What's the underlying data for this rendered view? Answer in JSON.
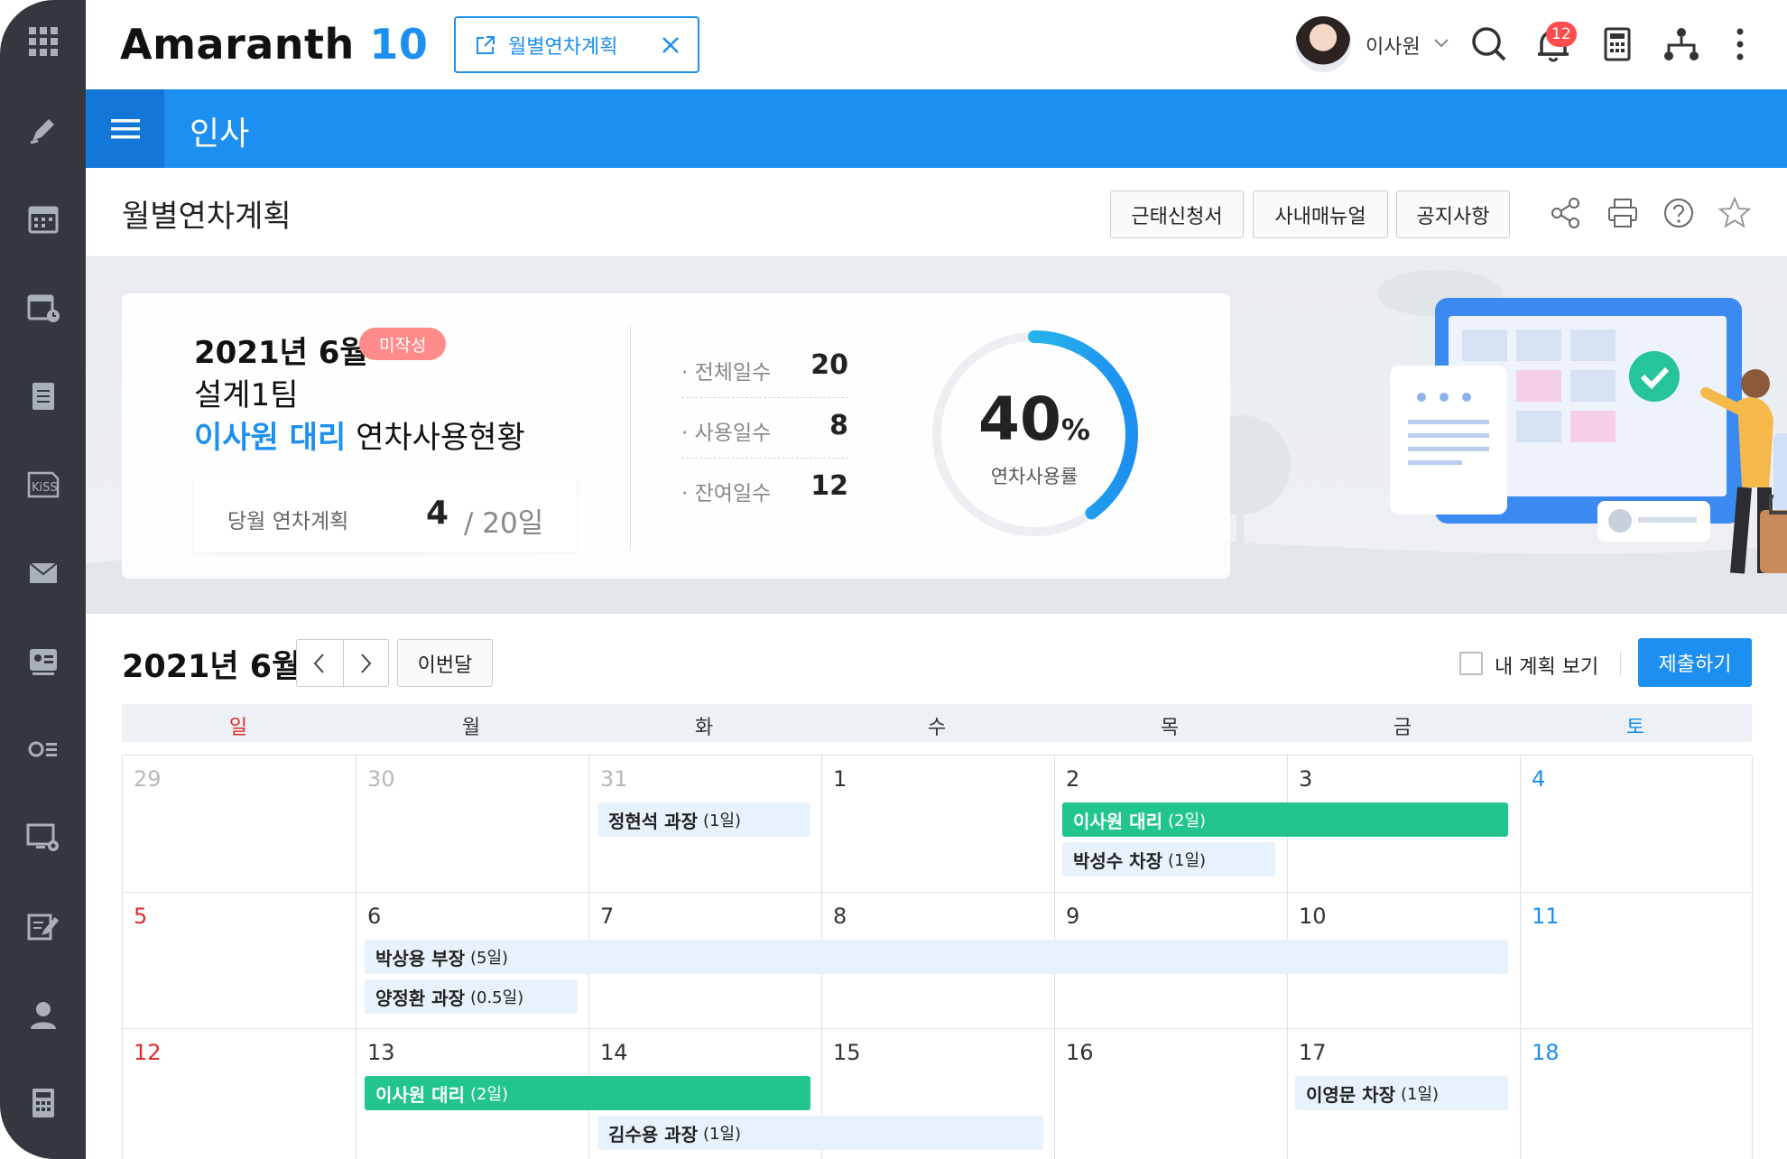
{
  "app": {
    "logo_text": "Amaranth",
    "logo_num": "10"
  },
  "open_tab": {
    "label": "월별연차계획"
  },
  "user": {
    "name": "이사원",
    "notification_count": "12"
  },
  "module": {
    "title": "인사"
  },
  "page": {
    "title": "월별연차계획",
    "buttons": [
      "근태신청서",
      "사내매뉴얼",
      "공지사항"
    ]
  },
  "summary": {
    "date": "2021년 6월",
    "status_badge": "미작성",
    "team": "설계1팀",
    "person_highlight": "이사원 대리",
    "person_suffix": "연차사용현황",
    "plan_label": "당월 연차계획",
    "plan_value": "4",
    "plan_total": "/ 20일",
    "stats": [
      {
        "label": "· 전체일수",
        "value": "20"
      },
      {
        "label": "· 사용일수",
        "value": "8"
      },
      {
        "label": "· 잔여일수",
        "value": "12"
      }
    ],
    "usage_percent": "40",
    "usage_percent_unit": "%",
    "usage_fraction": 0.4,
    "usage_label": "연차사용률"
  },
  "calendar": {
    "month_label": "2021년 6월",
    "this_month_label": "이번달",
    "my_plan_label": "내 계획 보기",
    "submit_label": "제출하기",
    "weekdays": [
      "일",
      "월",
      "화",
      "수",
      "목",
      "금",
      "토"
    ],
    "weeks": [
      [
        "29",
        "30",
        "31",
        "1",
        "2",
        "3",
        "4"
      ],
      [
        "5",
        "6",
        "7",
        "8",
        "9",
        "10",
        "11"
      ],
      [
        "12",
        "13",
        "14",
        "15",
        "16",
        "17",
        "18"
      ]
    ],
    "events": [
      {
        "name": "정현석 과장",
        "duration": "(1일)"
      },
      {
        "name": "이사원 대리",
        "duration": "(2일)"
      },
      {
        "name": "박성수 차장",
        "duration": "(1일)"
      },
      {
        "name": "박상용 부장",
        "duration": "(5일)"
      },
      {
        "name": "양정환 과장",
        "duration": "(0.5일)"
      },
      {
        "name": "이사원 대리",
        "duration": "(2일)"
      },
      {
        "name": "김수용 과장",
        "duration": "(1일)"
      },
      {
        "name": "이영문 차장",
        "duration": "(1일)"
      }
    ]
  },
  "colors": {
    "accent": "#1c8ff0",
    "green": "#22c58e",
    "sidebar": "#33383f",
    "badge": "#ff8b8b"
  }
}
